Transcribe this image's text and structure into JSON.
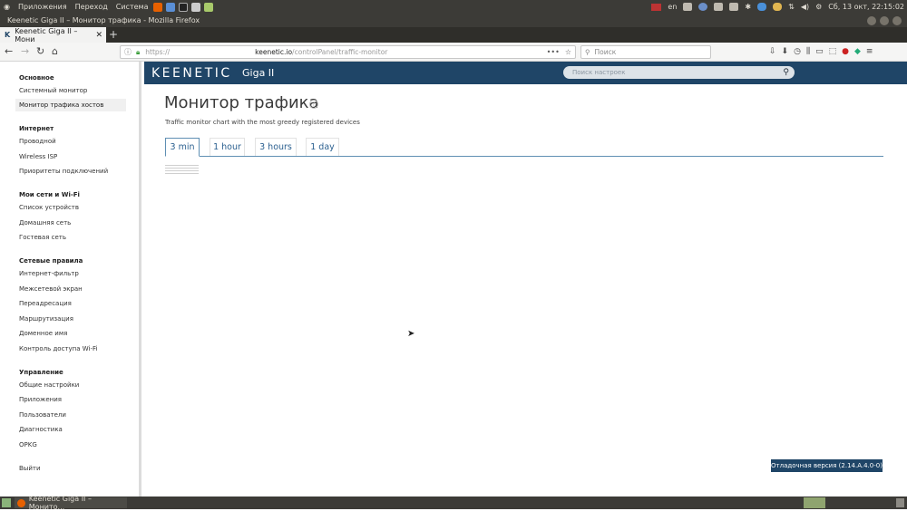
{
  "system_bar": {
    "menu": [
      "Приложения",
      "Переход",
      "Система"
    ],
    "lang": "en",
    "clock": "Сб, 13 окт, 22:15:02"
  },
  "window": {
    "title": "Keenetic Giga II – Монитор трафика - Mozilla Firefox"
  },
  "browser": {
    "tab_title": "Keenetic Giga II – Мони",
    "url_prefix": "https://",
    "url_host": "keenetic.io",
    "url_path": "/controlPanel/traffic-monitor",
    "search_placeholder": "Поиск"
  },
  "header": {
    "brand": "KEENETIC",
    "model": "Giga II",
    "search_placeholder": "Поиск настроек"
  },
  "sidebar": {
    "sections": [
      {
        "title": "Основное",
        "items": [
          "Системный монитор",
          "Монитор трафика хостов"
        ]
      },
      {
        "title": "Интернет",
        "items": [
          "Проводной",
          "Wireless ISP",
          "Приоритеты подключений"
        ]
      },
      {
        "title": "Мои сети и Wi-Fi",
        "items": [
          "Список устройств",
          "Домашняя сеть",
          "Гостевая сеть"
        ]
      },
      {
        "title": "Сетевые правила",
        "items": [
          "Интернет-фильтр",
          "Межсетевой экран",
          "Переадресация",
          "Маршрутизация",
          "Доменное имя",
          "Контроль доступа Wi-Fi"
        ]
      },
      {
        "title": "Управление",
        "items": [
          "Общие настройки",
          "Приложения",
          "Пользователи",
          "Диагностика",
          "OPKG"
        ]
      }
    ],
    "logout": "Выйти",
    "active_item": "Монитор трафика хостов"
  },
  "main": {
    "title": "Монитор трафика",
    "help": "?",
    "subtitle": "Traffic monitor chart with the most greedy registered devices",
    "tabs": [
      "3 min",
      "1 hour",
      "3 hours",
      "1 day"
    ],
    "active_tab": "3 min"
  },
  "footer": {
    "debug_badge": "Отладочная версия (2.14.A.4.0-0)"
  },
  "taskbar": {
    "task_title": "Keenetic Giga II – Монито..."
  }
}
